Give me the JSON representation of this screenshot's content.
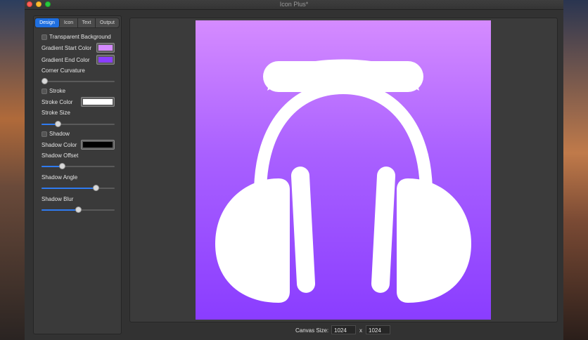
{
  "window": {
    "title": "Icon Plus*"
  },
  "tabs": [
    {
      "label": "Design",
      "active": true
    },
    {
      "label": "Icon",
      "active": false
    },
    {
      "label": "Text",
      "active": false
    },
    {
      "label": "Output",
      "active": false
    }
  ],
  "design": {
    "transparent_background": {
      "label": "Transparent Background",
      "checked": false
    },
    "gradient_start": {
      "label": "Gradient Start Color",
      "color": "#d58bff"
    },
    "gradient_end": {
      "label": "Gradient End Color",
      "color": "#8a3dff"
    },
    "corner_curvature": {
      "label": "Corner Curvature",
      "value": 0.04
    },
    "stroke": {
      "label": "Stroke",
      "checked": false
    },
    "stroke_color": {
      "label": "Stroke Color",
      "color": "#ffffff"
    },
    "stroke_size": {
      "label": "Stroke Size",
      "value": 0.22
    },
    "shadow": {
      "label": "Shadow",
      "checked": false
    },
    "shadow_color": {
      "label": "Shadow Color",
      "color": "#000000"
    },
    "shadow_offset": {
      "label": "Shadow Offset",
      "value": 0.28
    },
    "shadow_angle": {
      "label": "Shadow Angle",
      "value": 0.74
    },
    "shadow_blur": {
      "label": "Shadow Blur",
      "value": 0.5
    }
  },
  "canvas": {
    "icon": "headphones-icon",
    "icon_color": "#ffffff"
  },
  "canvas_size": {
    "label": "Canvas Size:",
    "width": "1024",
    "separator": "x",
    "height": "1024"
  }
}
